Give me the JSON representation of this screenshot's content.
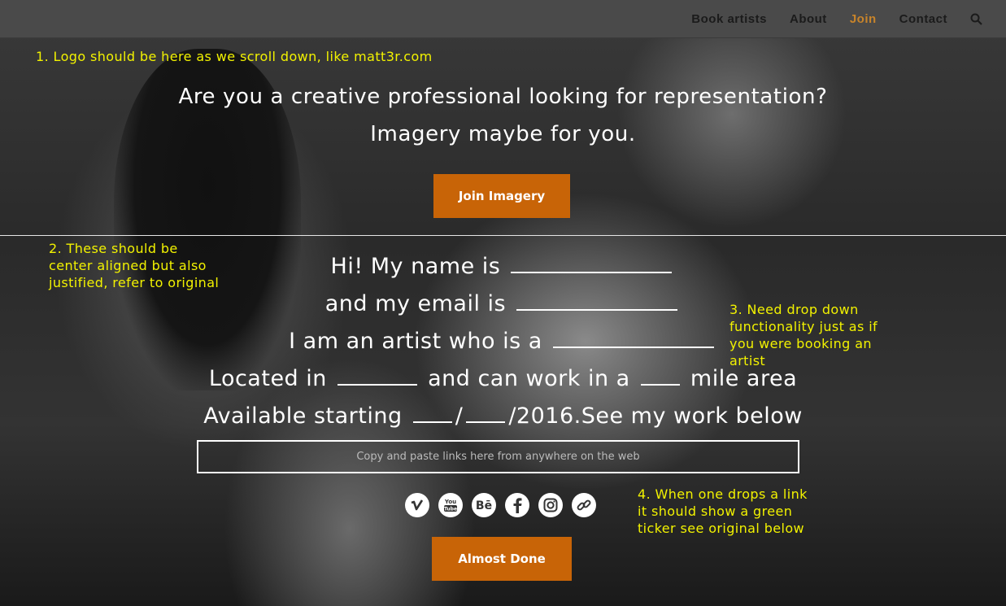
{
  "nav": {
    "items": [
      {
        "label": "Book artists",
        "active": false
      },
      {
        "label": "About",
        "active": false
      },
      {
        "label": "Join",
        "active": true
      },
      {
        "label": "Contact",
        "active": false
      }
    ],
    "active_color": "#c8842a"
  },
  "notes": {
    "note1": "1. Logo should be here as we scroll down, like matt3r.com",
    "note2": "2. These should be center aligned but also justified, refer to original",
    "note3": "3. Need drop down functionality just as if you were booking an artist",
    "note4": "4. When one drops a link it should show a green ticker see original below"
  },
  "hero": {
    "line1": "Are you a creative professional looking for representation?",
    "line2": "Imagery maybe for you.",
    "join_button": "Join Imagery"
  },
  "form": {
    "name_prefix": "Hi! My name is",
    "email_prefix": "and my email is",
    "artist_prefix": "I am an artist who is a",
    "located_prefix": "Located in",
    "located_mid": "and can work in a",
    "located_suffix": "mile area",
    "available_prefix": "Available starting",
    "date_sep": "/",
    "year_suffix": "/2016.See my work below",
    "links_placeholder": "Copy and paste links here from anywhere on the web",
    "done_button": "Almost Done"
  },
  "social_icons": [
    "vimeo-icon",
    "youtube-icon",
    "behance-icon",
    "facebook-icon",
    "instagram-icon",
    "link-icon"
  ],
  "colors": {
    "button": "#c86407",
    "note_text": "#f2f200"
  }
}
